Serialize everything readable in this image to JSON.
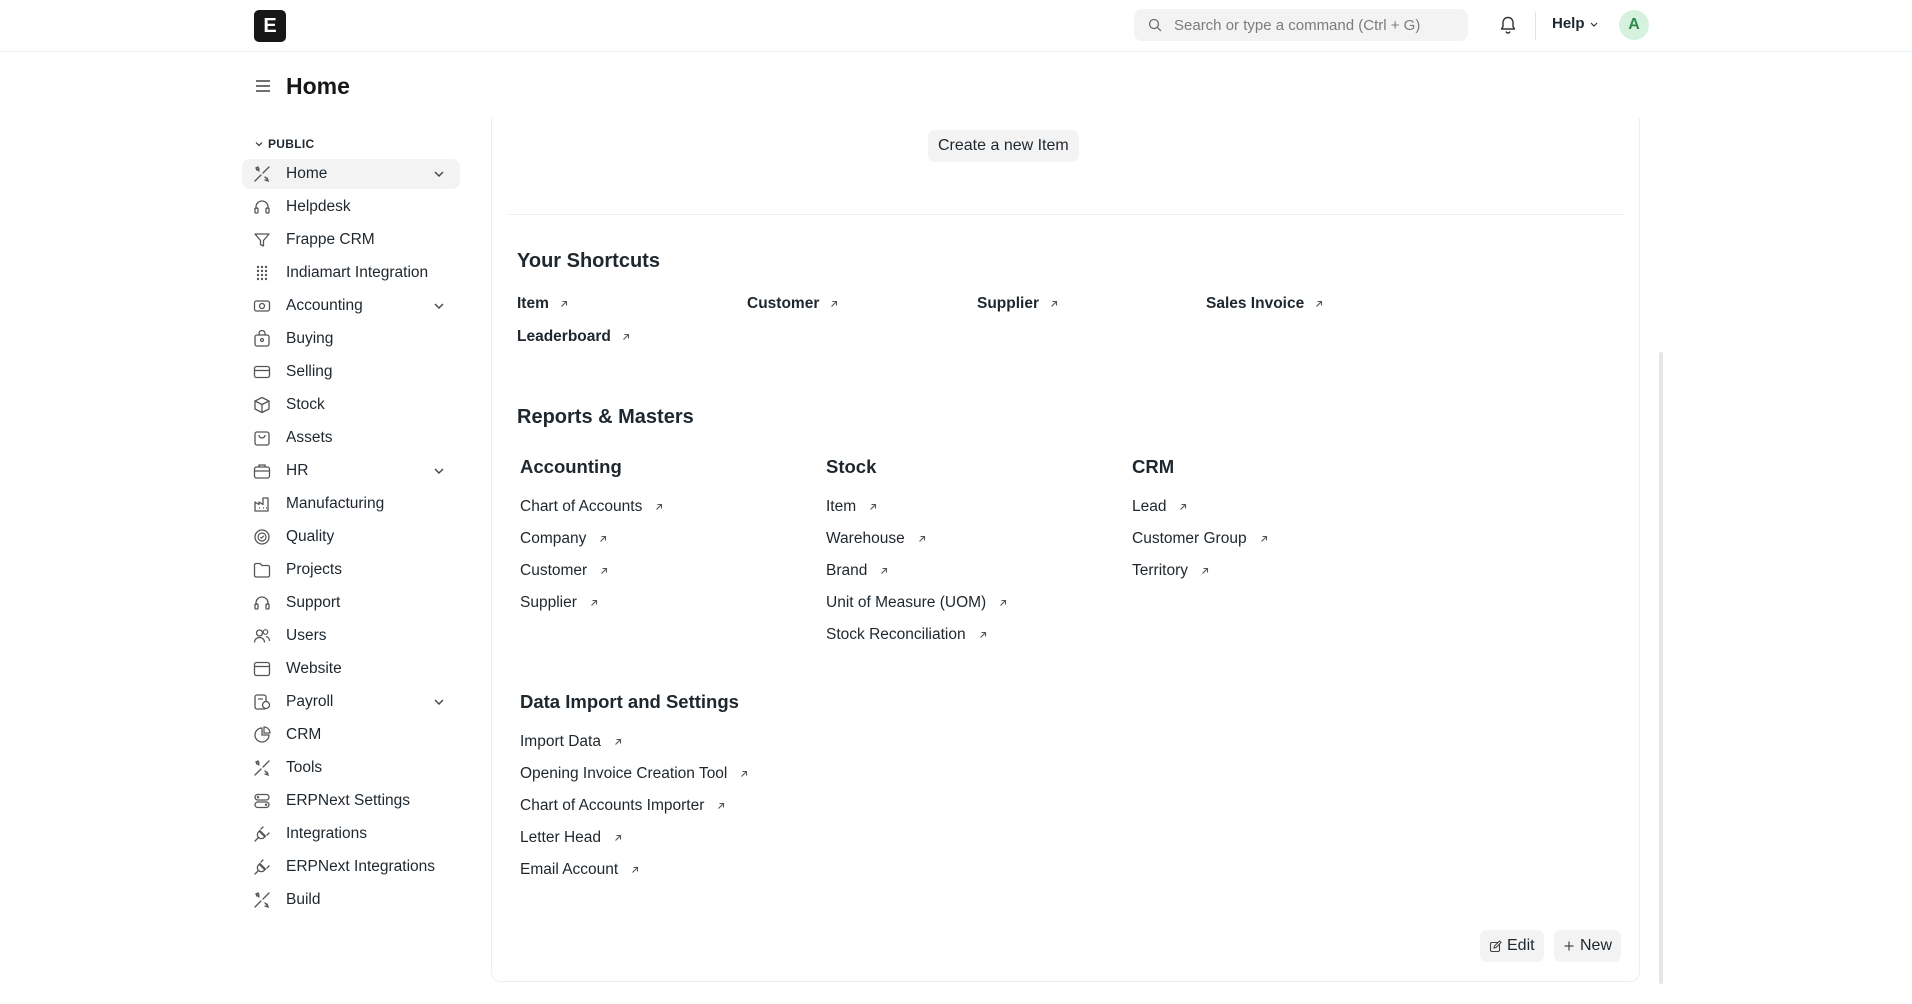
{
  "navbar": {
    "logo_letter": "E",
    "search_placeholder": "Search or type a command (Ctrl + G)",
    "help_label": "Help",
    "avatar_initial": "A"
  },
  "page": {
    "title": "Home"
  },
  "sidebar": {
    "section_label": "PUBLIC",
    "items": [
      {
        "label": "Home",
        "icon": "tools-icon",
        "expandable": true,
        "active": true
      },
      {
        "label": "Helpdesk",
        "icon": "headset-icon",
        "expandable": false
      },
      {
        "label": "Frappe CRM",
        "icon": "filter-icon",
        "expandable": false
      },
      {
        "label": "Indiamart Integration",
        "icon": "grid-dots-icon",
        "expandable": false
      },
      {
        "label": "Accounting",
        "icon": "money-icon",
        "expandable": true
      },
      {
        "label": "Buying",
        "icon": "bag-icon",
        "expandable": false
      },
      {
        "label": "Selling",
        "icon": "card-icon",
        "expandable": false
      },
      {
        "label": "Stock",
        "icon": "box-icon",
        "expandable": false
      },
      {
        "label": "Assets",
        "icon": "cart-icon",
        "expandable": false
      },
      {
        "label": "HR",
        "icon": "briefcase-icon",
        "expandable": true
      },
      {
        "label": "Manufacturing",
        "icon": "factory-icon",
        "expandable": false
      },
      {
        "label": "Quality",
        "icon": "quality-icon",
        "expandable": false
      },
      {
        "label": "Projects",
        "icon": "folder-icon",
        "expandable": false
      },
      {
        "label": "Support",
        "icon": "headset-icon",
        "expandable": false
      },
      {
        "label": "Users",
        "icon": "users-icon",
        "expandable": false
      },
      {
        "label": "Website",
        "icon": "browser-icon",
        "expandable": false
      },
      {
        "label": "Payroll",
        "icon": "payroll-icon",
        "expandable": true
      },
      {
        "label": "CRM",
        "icon": "pie-icon",
        "expandable": false
      },
      {
        "label": "Tools",
        "icon": "tools-icon",
        "expandable": false
      },
      {
        "label": "ERPNext Settings",
        "icon": "settings-icon",
        "expandable": false
      },
      {
        "label": "Integrations",
        "icon": "plug-icon",
        "expandable": false
      },
      {
        "label": "ERPNext Integrations",
        "icon": "plug-icon",
        "expandable": false
      },
      {
        "label": "Build",
        "icon": "tools-icon",
        "expandable": false
      }
    ]
  },
  "main": {
    "create_button": "Create a new Item",
    "shortcuts_title": "Your Shortcuts",
    "shortcuts": [
      "Item",
      "Customer",
      "Supplier",
      "Sales Invoice",
      "Leaderboard"
    ],
    "reports_title": "Reports & Masters",
    "cards": [
      {
        "title": "Accounting",
        "links": [
          "Chart of Accounts",
          "Company",
          "Customer",
          "Supplier"
        ]
      },
      {
        "title": "Stock",
        "links": [
          "Item",
          "Warehouse",
          "Brand",
          "Unit of Measure (UOM)",
          "Stock Reconciliation"
        ]
      },
      {
        "title": "CRM",
        "links": [
          "Lead",
          "Customer Group",
          "Territory"
        ]
      },
      {
        "title": "Data Import and Settings",
        "links": [
          "Import Data",
          "Opening Invoice Creation Tool",
          "Chart of Accounts Importer",
          "Letter Head",
          "Email Account"
        ]
      }
    ],
    "edit_label": "Edit",
    "new_label": "New"
  }
}
